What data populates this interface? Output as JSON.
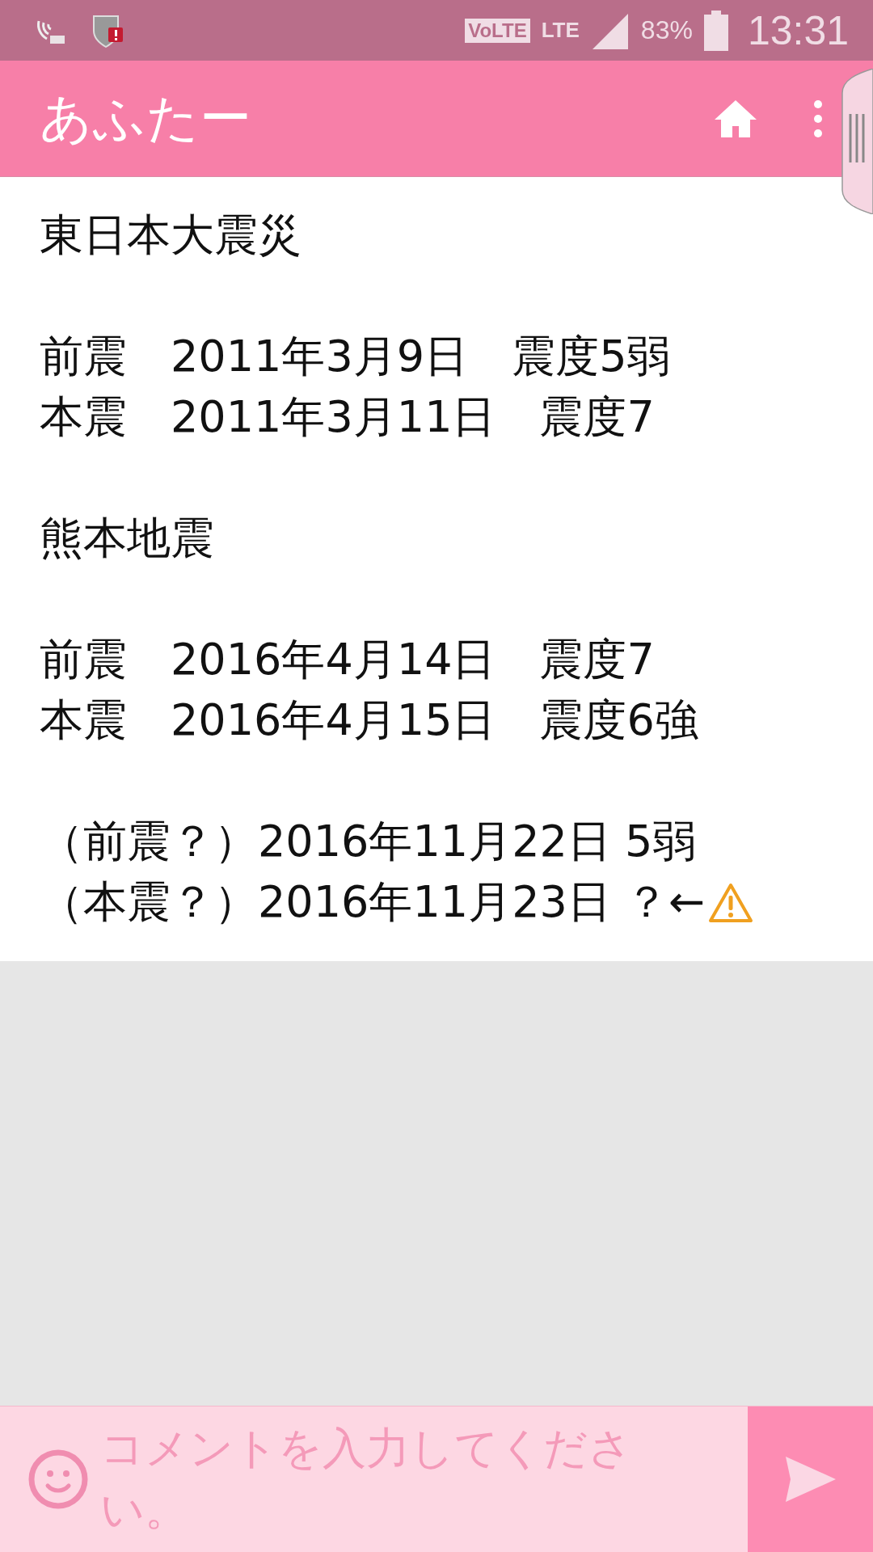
{
  "status_bar": {
    "battery_text": "83%",
    "time": "13:31",
    "network": "LTE",
    "volte": "VoLTE"
  },
  "app_bar": {
    "title": "あふたー"
  },
  "post": {
    "paragraphs": [
      {
        "lines": [
          {
            "text": "東日本大震災"
          }
        ]
      },
      {
        "lines": [
          {
            "text": "前震　2011年3月9日　震度5弱"
          },
          {
            "text": "本震　2011年3月11日　震度7"
          }
        ]
      },
      {
        "lines": [
          {
            "text": "熊本地震"
          }
        ]
      },
      {
        "lines": [
          {
            "text": "前震　2016年4月14日　震度7"
          },
          {
            "text": "本震　2016年4月15日　震度6強"
          }
        ]
      },
      {
        "lines": [
          {
            "text": "（前震？）2016年11月22日 5弱"
          },
          {
            "text": "（本震？）2016年11月23日 ？←",
            "warning_icon": true
          }
        ]
      }
    ]
  },
  "comment_bar": {
    "placeholder": "コメントを入力してください。"
  }
}
